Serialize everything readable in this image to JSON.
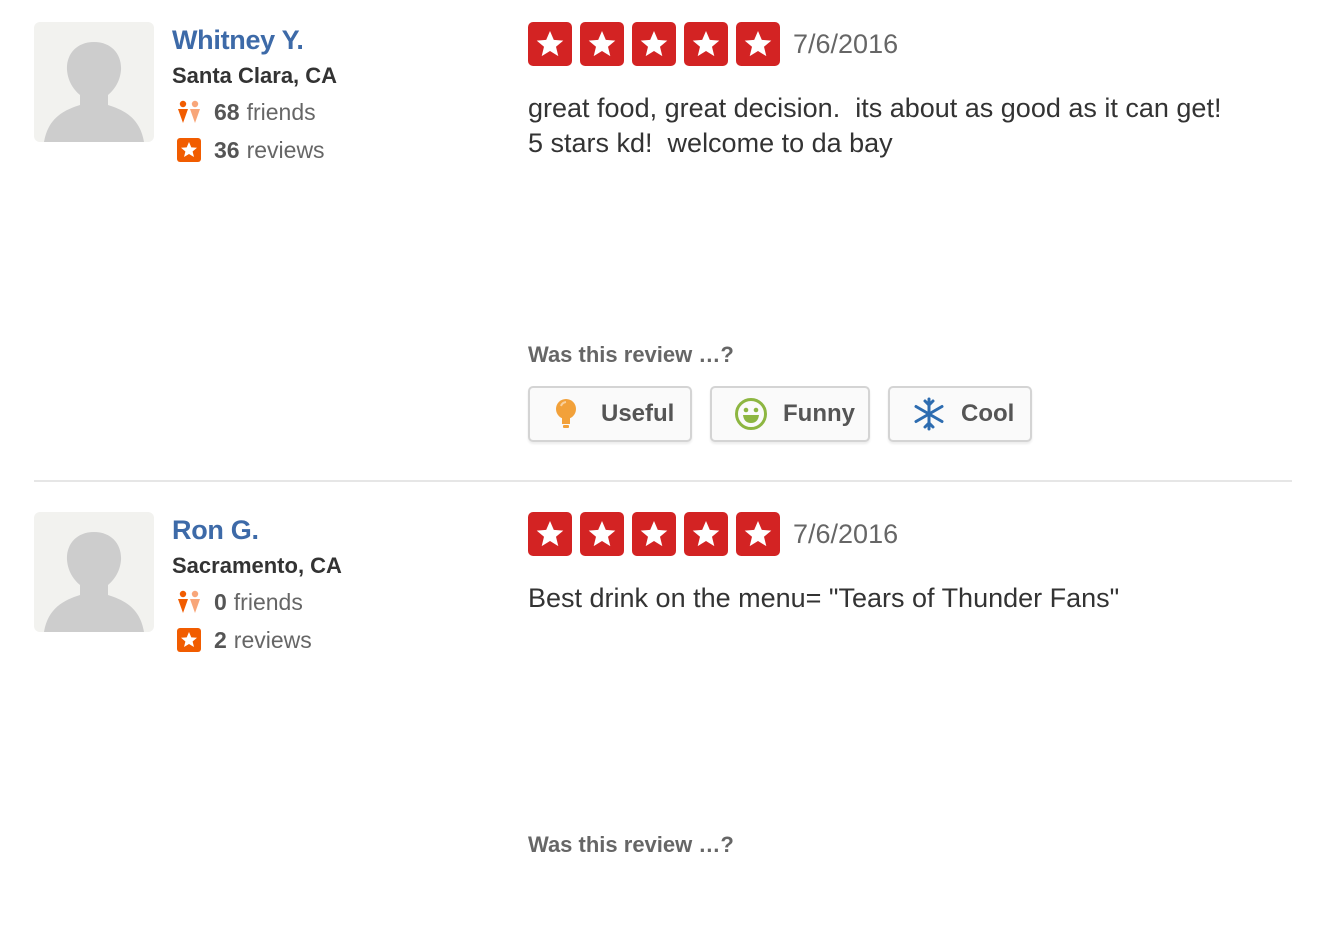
{
  "colors": {
    "user_name": "#3d6aa8",
    "star_red": "#d32323",
    "friends_icon": "#f15c00",
    "reviews_icon": "#f15c00",
    "useful_icon": "#f2a13a",
    "funny_icon": "#8db641",
    "cool_icon": "#2d6cb0"
  },
  "reviews": [
    {
      "user": {
        "name": "Whitney Y.",
        "location": "Santa Clara, CA",
        "friends_count": "68",
        "friends_label": "friends",
        "reviews_count": "36",
        "reviews_label": "reviews",
        "avatar_icon": "default-avatar-icon"
      },
      "rating": 5,
      "date": "7/6/2016",
      "text": "great food, great decision.  its about as good as it can get!\n5 stars kd!  welcome to da bay",
      "vote_prompt": "Was this review …?",
      "buttons": {
        "useful": "Useful",
        "funny": "Funny",
        "cool": "Cool"
      }
    },
    {
      "user": {
        "name": "Ron G.",
        "location": "Sacramento, CA",
        "friends_count": "0",
        "friends_label": "friends",
        "reviews_count": "2",
        "reviews_label": "reviews",
        "avatar_icon": "default-avatar-icon"
      },
      "rating": 5,
      "date": "7/6/2016",
      "text": "Best drink on the menu= \"Tears of Thunder Fans\"",
      "vote_prompt": "Was this review …?"
    }
  ]
}
